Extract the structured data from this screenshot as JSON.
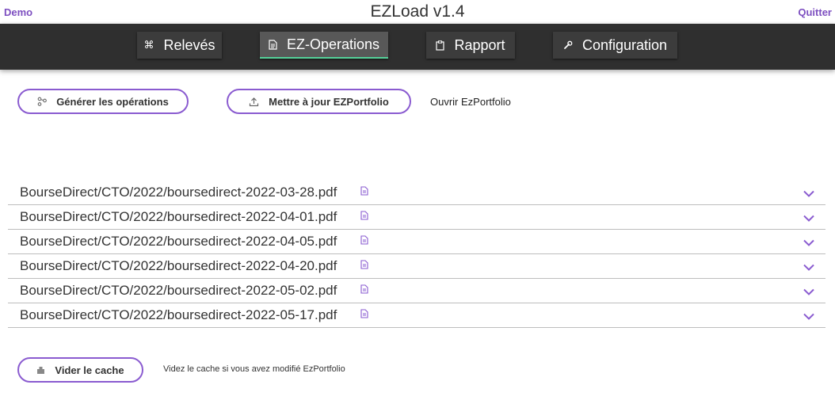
{
  "header": {
    "demo_label": "Demo",
    "title": "EZLoad v1.4",
    "quit_label": "Quitter"
  },
  "nav": {
    "tabs": [
      {
        "label": "Relevés",
        "icon": "command-icon"
      },
      {
        "label": "EZ-Operations",
        "icon": "document-icon",
        "active": true
      },
      {
        "label": "Rapport",
        "icon": "clipboard-icon"
      },
      {
        "label": "Configuration",
        "icon": "wrench-icon"
      }
    ]
  },
  "actions": {
    "generate_label": "Générer les opérations",
    "update_label": "Mettre à jour EZPortfolio",
    "open_label": "Ouvrir EzPortfolio"
  },
  "files": [
    "BourseDirect/CTO/2022/boursedirect-2022-03-28.pdf",
    "BourseDirect/CTO/2022/boursedirect-2022-04-01.pdf",
    "BourseDirect/CTO/2022/boursedirect-2022-04-05.pdf",
    "BourseDirect/CTO/2022/boursedirect-2022-04-20.pdf",
    "BourseDirect/CTO/2022/boursedirect-2022-05-02.pdf",
    "BourseDirect/CTO/2022/boursedirect-2022-05-17.pdf"
  ],
  "cache": {
    "button_label": "Vider le cache",
    "hint": "Videz le cache si vous avez modifié EzPortfolio"
  },
  "colors": {
    "accent": "#8a5bd0",
    "nav_bg": "#2f2f2f",
    "active_underline": "#55d19a"
  }
}
